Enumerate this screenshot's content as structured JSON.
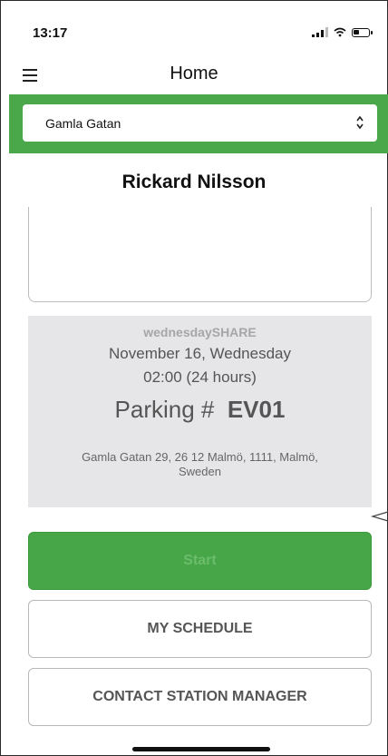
{
  "status_bar": {
    "time": "13:17",
    "icons": [
      "signal-icon",
      "wifi-icon",
      "battery-icon"
    ]
  },
  "header": {
    "title": "Home",
    "menu_icon": "hamburger-menu-icon"
  },
  "location_select": {
    "selected": "Gamla Gatan",
    "arrow_icon": "up-down-chevron-icon"
  },
  "user": {
    "name": "Rickard Nilsson"
  },
  "booking": {
    "label": "wednesdaySHARE",
    "date": "November 16, Wednesday",
    "time": "02:00 (24 hours)",
    "parking_prefix": "Parking #",
    "parking_id": "EV01",
    "address": "Gamla Gatan 29, 26 12 Malmö, 1111, Malmö, Sweden"
  },
  "buttons": {
    "start": "Start",
    "my_schedule": "MY SCHEDULE",
    "contact_manager": "CONTACT STATION MANAGER"
  },
  "colors": {
    "accent_green": "#4aa84a",
    "card_gray": "#e6e6e9"
  }
}
